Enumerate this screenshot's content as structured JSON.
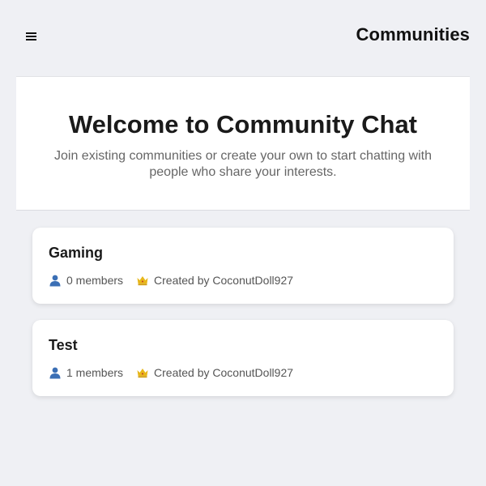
{
  "header": {
    "menu_icon": "hamburger-menu-icon",
    "title": "Communities"
  },
  "hero": {
    "title": "Welcome to Community Chat",
    "subtitle": "Join existing communities or create your own to start chatting with people who share your interests."
  },
  "communities": [
    {
      "name": "Gaming",
      "members_label": "0 members",
      "creator_label": "Created by CoconutDoll927"
    },
    {
      "name": "Test",
      "members_label": "1 members",
      "creator_label": "Created by CoconutDoll927"
    }
  ],
  "icons": {
    "members": "person-icon",
    "creator": "crown-icon"
  },
  "colors": {
    "background": "#eff0f4",
    "card": "#ffffff",
    "person_icon": "#3b6fb5",
    "crown_icon": "#e8b71a"
  }
}
